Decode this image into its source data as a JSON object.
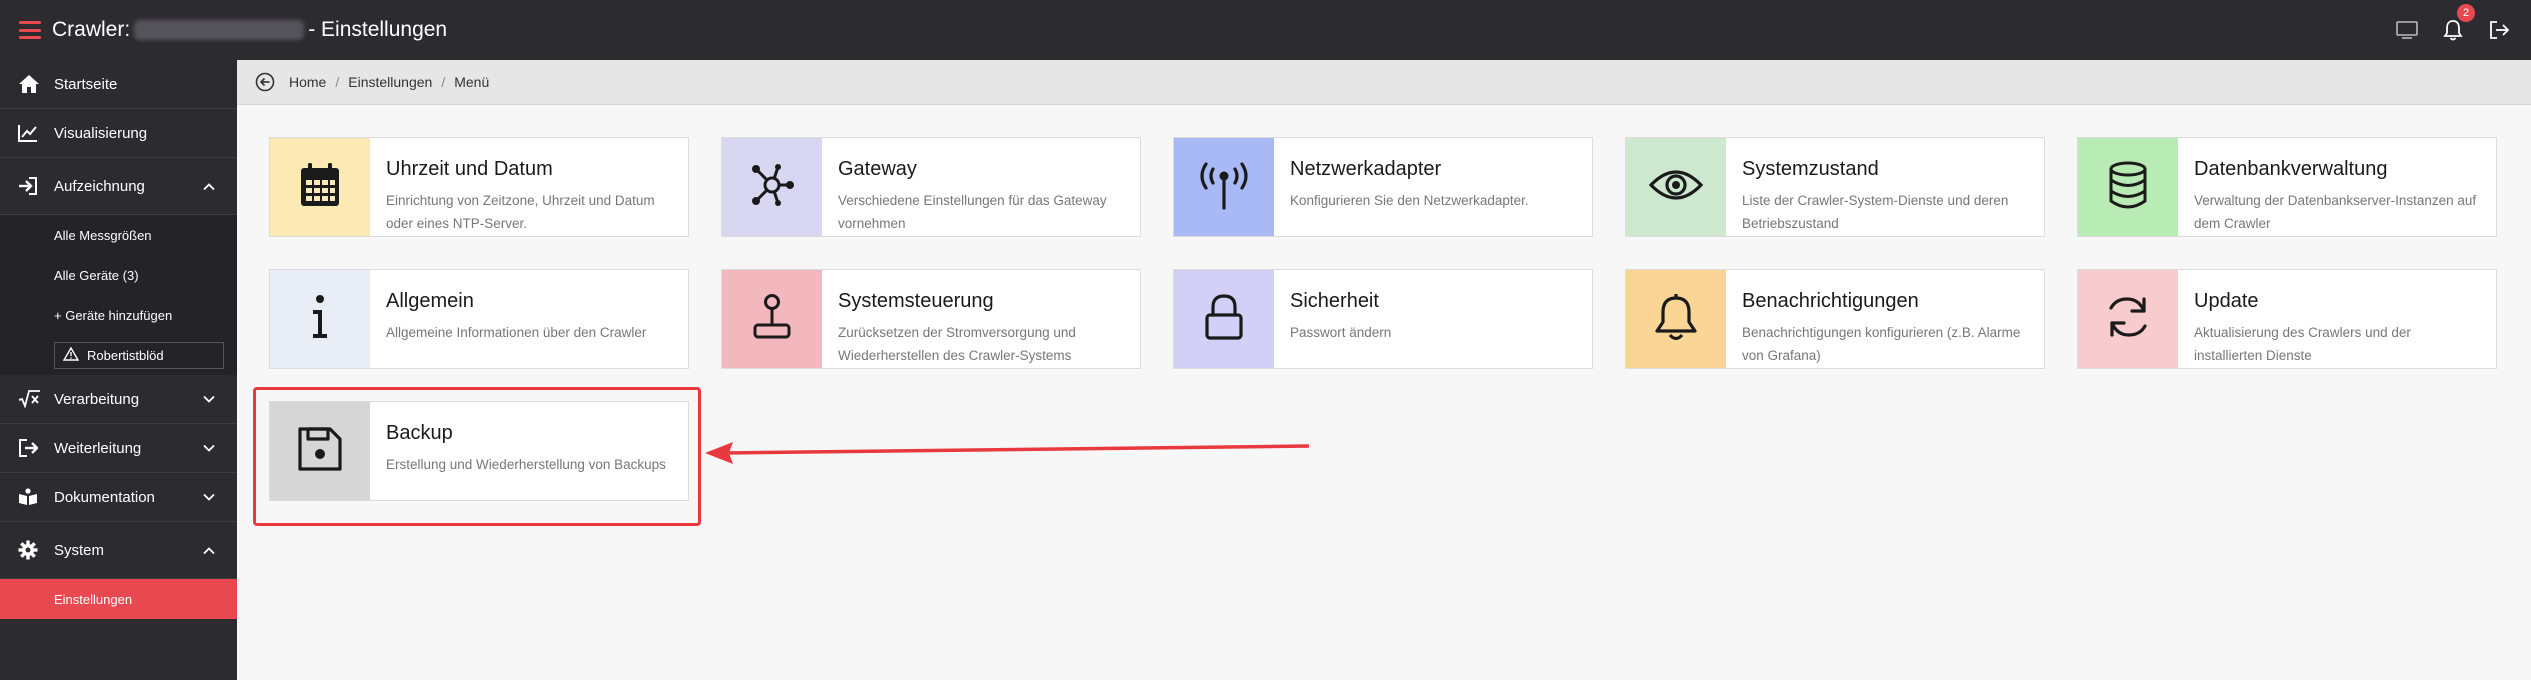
{
  "header": {
    "app_prefix": "Crawler:",
    "app_suffix": "- Einstellungen",
    "notification_count": "2",
    "icons": [
      "monitor-icon",
      "bell-icon",
      "logout-icon"
    ]
  },
  "sidebar": {
    "items": [
      {
        "label": "Startseite",
        "icon": "home-icon"
      },
      {
        "label": "Visualisierung",
        "icon": "chart-line-icon"
      },
      {
        "label": "Aufzeichnung",
        "icon": "sign-in-icon",
        "expanded": true
      },
      {
        "label": "Verarbeitung",
        "icon": "sqrt-icon",
        "expanded": false
      },
      {
        "label": "Weiterleitung",
        "icon": "sign-out-icon",
        "expanded": false
      },
      {
        "label": "Dokumentation",
        "icon": "book-icon",
        "expanded": false
      },
      {
        "label": "System",
        "icon": "gear-icon",
        "expanded": true
      }
    ],
    "aufzeichnung_sub": [
      {
        "label": "Alle Messgrößen"
      },
      {
        "label": "Alle Geräte (3)"
      },
      {
        "label": "+ Geräte hinzufügen"
      },
      {
        "label": "Robertistblöd",
        "icon": "warning-icon"
      }
    ],
    "system_sub": [
      {
        "label": "Einstellungen",
        "active": true
      }
    ]
  },
  "breadcrumb": {
    "items": [
      "Home",
      "Einstellungen",
      "Menü"
    ],
    "separator": "/"
  },
  "cards": [
    {
      "title": "Uhrzeit und Datum",
      "desc": "Einrichtung von Zeitzone, Uhrzeit und Datum oder eines NTP-Server.",
      "icon": "calendar-icon",
      "color": "#fde9b3"
    },
    {
      "title": "Gateway",
      "desc": "Verschiedene Einstellungen für das Gateway vornehmen",
      "icon": "hub-icon",
      "color": "#d9d6f2"
    },
    {
      "title": "Netzwerkadapter",
      "desc": "Konfigurieren Sie den Netzwerkadapter.",
      "icon": "antenna-icon",
      "color": "#a9b9f5"
    },
    {
      "title": "Systemzustand",
      "desc": "Liste der Crawler-System-Dienste und deren Betriebszustand",
      "icon": "eye-icon",
      "color": "#cde8cf"
    },
    {
      "title": "Datenbankverwaltung",
      "desc": "Verwaltung der Datenbankserver-Instanzen auf dem Crawler",
      "icon": "database-icon",
      "color": "#b9ebb4"
    },
    {
      "title": "Allgemein",
      "desc": "Allgemeine Informationen über den Crawler",
      "icon": "info-icon",
      "color": "#e9edf5"
    },
    {
      "title": "Systemsteuerung",
      "desc": "Zurücksetzen der Stromversorgung und Wiederherstellen des Crawler-Systems",
      "icon": "joystick-icon",
      "color": "#f2b8bd"
    },
    {
      "title": "Sicherheit",
      "desc": "Passwort ändern",
      "icon": "lock-icon",
      "color": "#d3d0f7"
    },
    {
      "title": "Benachrichtigungen",
      "desc": "Benachrichtigungen konfigurieren (z.B. Alarme von Grafana)",
      "icon": "bell-icon",
      "color": "#fbd596"
    },
    {
      "title": "Update",
      "desc": "Aktualisierung des Crawlers und der installierten Dienste",
      "icon": "refresh-icon",
      "color": "#f8cccf"
    },
    {
      "title": "Backup",
      "desc": "Erstellung und Wiederherstellung von Backups",
      "icon": "floppy-icon",
      "color": "#d6d6d6"
    }
  ],
  "colors": {
    "accent": "#e8484f",
    "sidebar_bg": "#2c2b30",
    "highlight": "#e8393f"
  }
}
